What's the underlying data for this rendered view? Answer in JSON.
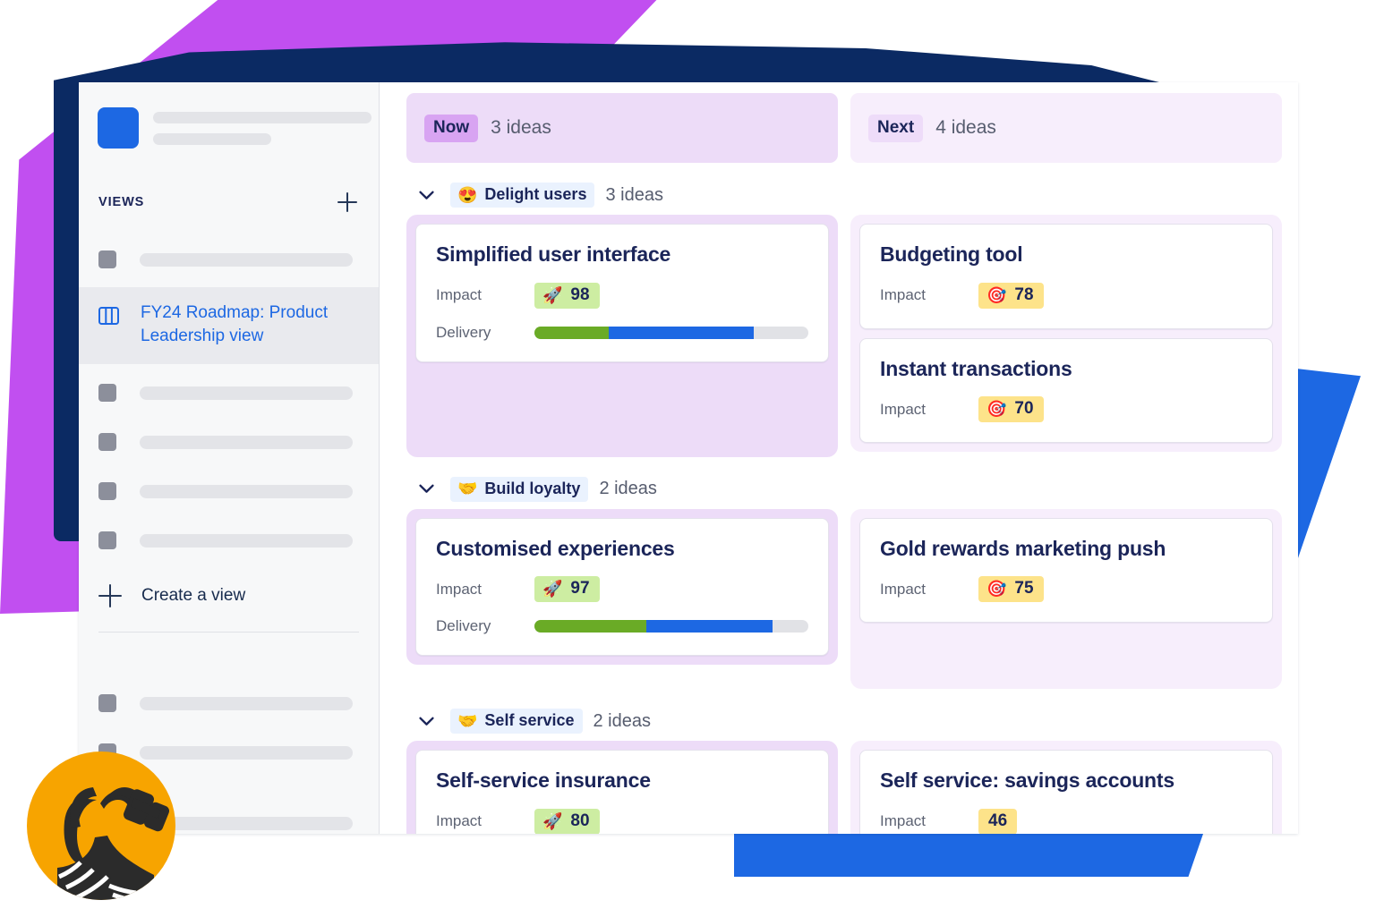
{
  "sidebar": {
    "views_header": "VIEWS",
    "add_view_icon": "plus-icon",
    "active_view": {
      "label": "FY24 Roadmap: Product Leadership view",
      "icon": "board-columns-icon"
    },
    "create_view": {
      "label": "Create a view",
      "icon": "plus-icon"
    }
  },
  "board": {
    "columns": [
      {
        "id": "now",
        "pill": "Now",
        "count": "3 ideas"
      },
      {
        "id": "next",
        "pill": "Next",
        "count": "4 ideas"
      }
    ],
    "groups": [
      {
        "id": "delight-users",
        "emoji": "😍",
        "emoji_name": "smiling-face-with-hearts-icon",
        "name": "Delight users",
        "count": "3 ideas",
        "chevron": "chevron-down-icon",
        "now_cards": [
          {
            "title": "Simplified user interface",
            "impact_label": "Impact",
            "impact_value": "98",
            "impact_emoji": "🚀",
            "impact_emoji_name": "rocket-icon",
            "impact_tone": "green",
            "delivery_label": "Delivery",
            "delivery_green_pct": 27,
            "delivery_blue_pct": 53,
            "delivery_grey_pct": 20
          }
        ],
        "next_cards": [
          {
            "title": "Budgeting tool",
            "impact_label": "Impact",
            "impact_value": "78",
            "impact_emoji": "🎯",
            "impact_emoji_name": "target-icon",
            "impact_tone": "yellow"
          },
          {
            "title": "Instant transactions",
            "impact_label": "Impact",
            "impact_value": "70",
            "impact_emoji": "🎯",
            "impact_emoji_name": "target-icon",
            "impact_tone": "yellow"
          }
        ]
      },
      {
        "id": "build-loyalty",
        "emoji": "🤝",
        "emoji_name": "handshake-icon",
        "name": "Build loyalty",
        "count": "2 ideas",
        "chevron": "chevron-down-icon",
        "now_cards": [
          {
            "title": "Customised experiences",
            "impact_label": "Impact",
            "impact_value": "97",
            "impact_emoji": "🚀",
            "impact_emoji_name": "rocket-icon",
            "impact_tone": "green",
            "delivery_label": "Delivery",
            "delivery_green_pct": 41,
            "delivery_blue_pct": 46,
            "delivery_grey_pct": 13
          }
        ],
        "next_cards": [
          {
            "title": "Gold rewards marketing push",
            "impact_label": "Impact",
            "impact_value": "75",
            "impact_emoji": "🎯",
            "impact_emoji_name": "target-icon",
            "impact_tone": "yellow"
          }
        ]
      },
      {
        "id": "self-service",
        "emoji": "🤝",
        "emoji_name": "handshake-icon",
        "name": "Self service",
        "count": "2 ideas",
        "chevron": "chevron-down-icon",
        "now_cards": [
          {
            "title": "Self-service insurance",
            "impact_label": "Impact",
            "impact_value": "80",
            "impact_emoji": "🚀",
            "impact_emoji_name": "rocket-icon",
            "impact_tone": "green"
          }
        ],
        "next_cards": [
          {
            "title": "Self service: savings accounts",
            "impact_label": "Impact",
            "impact_value": "46",
            "impact_emoji": "",
            "impact_emoji_name": "none",
            "impact_tone": "yellow"
          }
        ]
      }
    ]
  },
  "colors": {
    "accent_blue": "#1D68E3",
    "deco_purple": "#C14FF0",
    "deco_navy": "#0B2A63",
    "deco_blue": "#1D68E3",
    "now_zone": "#EDDCF8",
    "next_zone": "#F7EEFC",
    "now_pill": "#D8A4F2",
    "next_pill": "#EEDCF9",
    "badge_green": "#CDEDA2",
    "badge_yellow": "#FDE38A",
    "progress_green": "#6AAB26",
    "progress_blue": "#1D68E3",
    "avatar_bg": "#F7A400"
  }
}
